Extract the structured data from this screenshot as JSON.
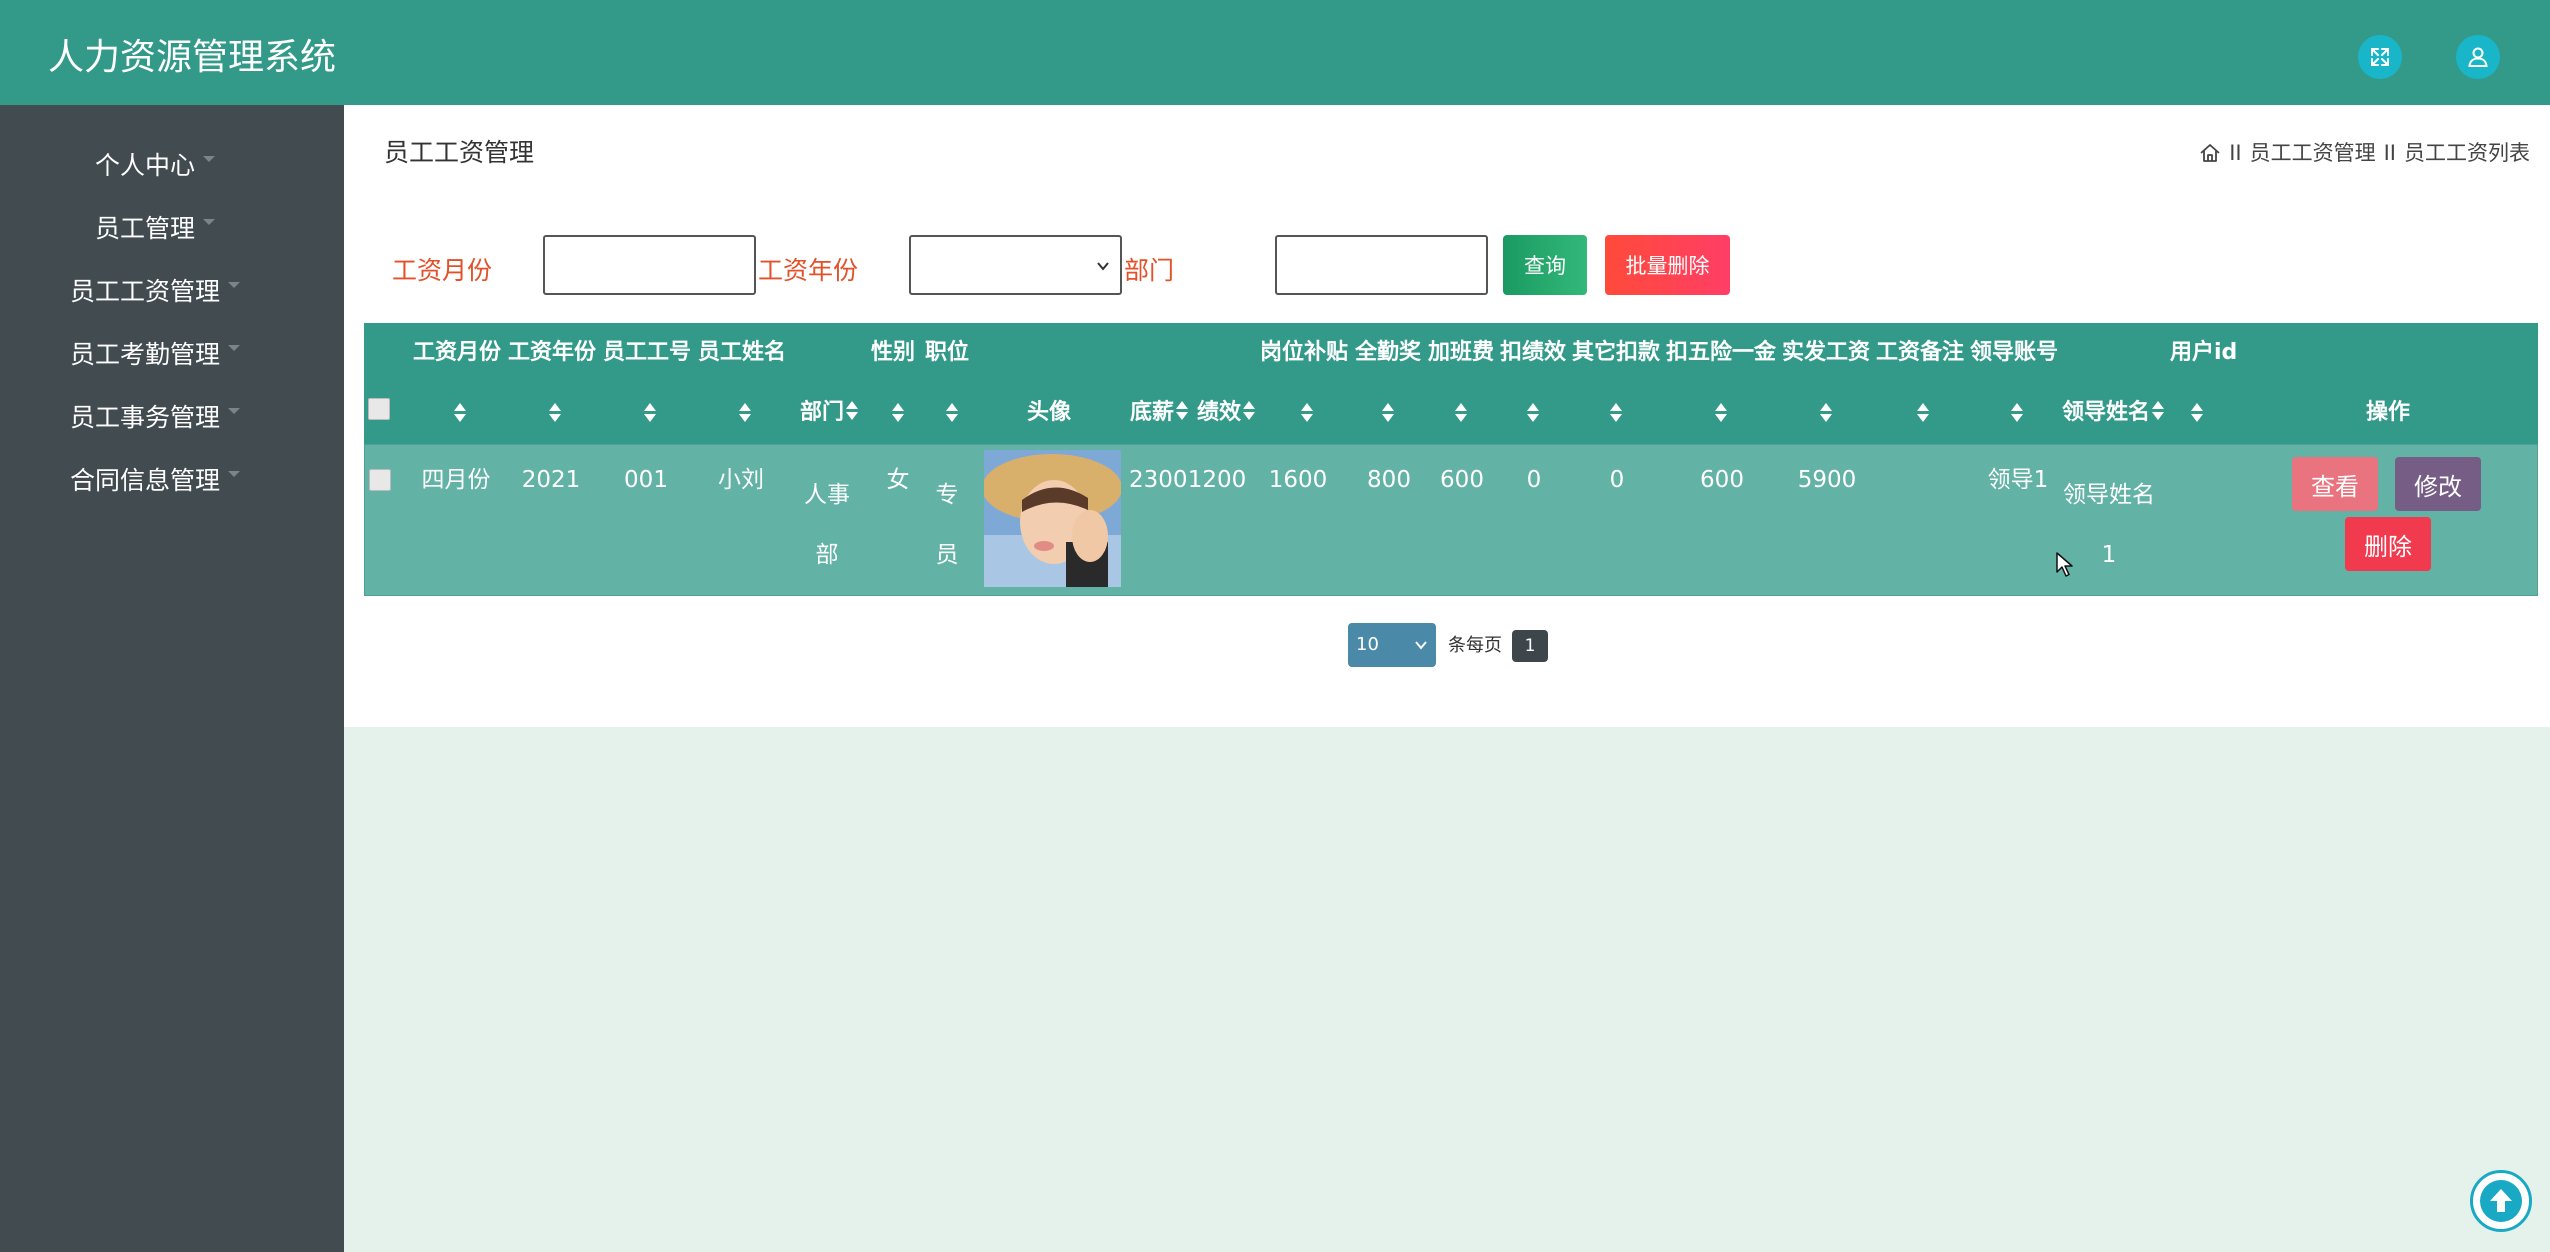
{
  "app": {
    "title": "人力资源管理系统"
  },
  "header_icons": [
    "fullscreen-icon",
    "user-icon"
  ],
  "sidebar": {
    "items": [
      {
        "label": "个人中心"
      },
      {
        "label": "员工管理"
      },
      {
        "label": "员工工资管理"
      },
      {
        "label": "员工考勤管理"
      },
      {
        "label": "员工事务管理"
      },
      {
        "label": "合同信息管理"
      }
    ]
  },
  "page": {
    "title": "员工工资管理",
    "breadcrumb": [
      "员工工资管理",
      "员工工资列表"
    ],
    "breadcrumb_sep": "II"
  },
  "filters": {
    "salary_month_label": "工资月份",
    "salary_month_value": "",
    "salary_year_label": "工资年份",
    "salary_year_value": "",
    "department_label": "部门",
    "department_value": "",
    "search_label": "查询",
    "batch_delete_label": "批量删除"
  },
  "table": {
    "headers_top": {
      "month": "工资月份",
      "year": "工资年份",
      "emp_no": "员工工号",
      "emp_name": "员工姓名",
      "gender": "性别",
      "position": "职位",
      "post_allowance": "岗位补贴",
      "attendance_bonus": "全勤奖",
      "overtime": "加班费",
      "perf_deduct": "扣绩效",
      "other_deduct": "其它扣款",
      "insurance_deduct": "扣五险一金",
      "actual_salary": "实发工资",
      "salary_note": "工资备注",
      "leader_account": "领导账号",
      "user_id": "用户id"
    },
    "headers_bottom": {
      "department": "部门",
      "avatar": "头像",
      "base_salary": "底薪",
      "performance": "绩效",
      "leader_name": "领导姓名",
      "actions": "操作"
    },
    "rows": [
      {
        "month": "四月份",
        "year": "2021",
        "emp_no": "001",
        "emp_name": "小刘",
        "department": "人事部",
        "gender": "女",
        "position": "专员",
        "base_salary": "2300",
        "performance": "1200",
        "post_allowance": "1600",
        "attendance_bonus": "800",
        "overtime": "600",
        "perf_deduct": "0",
        "other_deduct": "0",
        "insurance_deduct": "600",
        "actual_salary": "5900",
        "salary_note": "",
        "leader_account": "领导1",
        "leader_name": "领导姓名1",
        "user_id": "",
        "view_label": "查看",
        "edit_label": "修改",
        "delete_label": "删除"
      }
    ]
  },
  "pagination": {
    "page_size": "10",
    "per_page_label": "条每页",
    "current_page": "1"
  },
  "colors": {
    "header": "#339a8a",
    "sidebar": "#424b50",
    "row": "#62b2a6",
    "search_button": "#1ea26a",
    "batch_delete_button": "#ff3e4d",
    "view_button": "#e9737e",
    "edit_button": "#765d85",
    "delete_button": "#f23a4f",
    "filter_label": "#e2512a"
  }
}
